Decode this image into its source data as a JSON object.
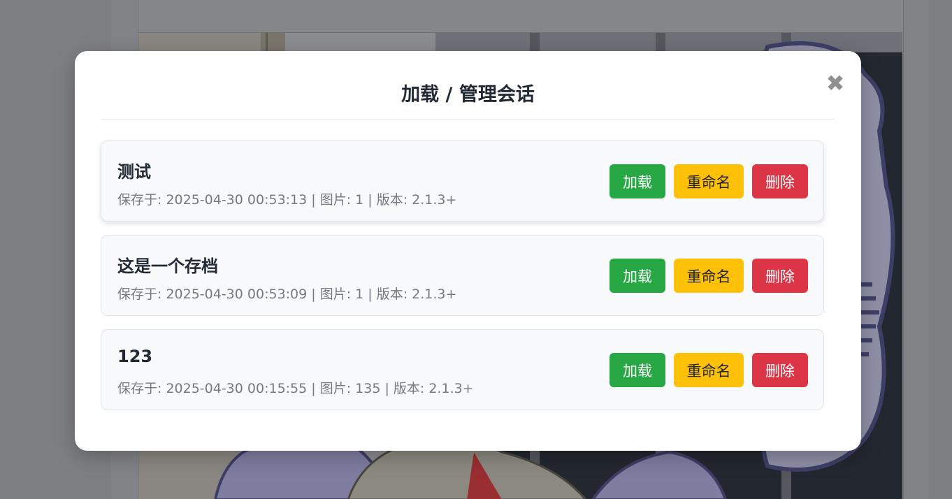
{
  "modal": {
    "title": "加载 / 管理会话",
    "close_icon": "✖"
  },
  "sessions": [
    {
      "name": "测试",
      "meta": "保存于: 2025-04-30 00:53:13 | 图片: 1 | 版本: 2.1.3+",
      "load_label": "加载",
      "rename_label": "重命名",
      "delete_label": "删除"
    },
    {
      "name": "这是一个存档",
      "meta": "保存于: 2025-04-30 00:53:09 | 图片: 1 | 版本: 2.1.3+",
      "load_label": "加载",
      "rename_label": "重命名",
      "delete_label": "删除"
    },
    {
      "name": "123",
      "meta": "保存于: 2025-04-30 00:15:55 | 图片: 135 | 版本: 2.1.3+",
      "load_label": "加载",
      "rename_label": "重命名",
      "delete_label": "删除"
    }
  ],
  "colors": {
    "load": "#28a745",
    "rename": "#ffc107",
    "delete": "#dc3545",
    "overlay": "rgba(0,0,0,0.5)"
  }
}
